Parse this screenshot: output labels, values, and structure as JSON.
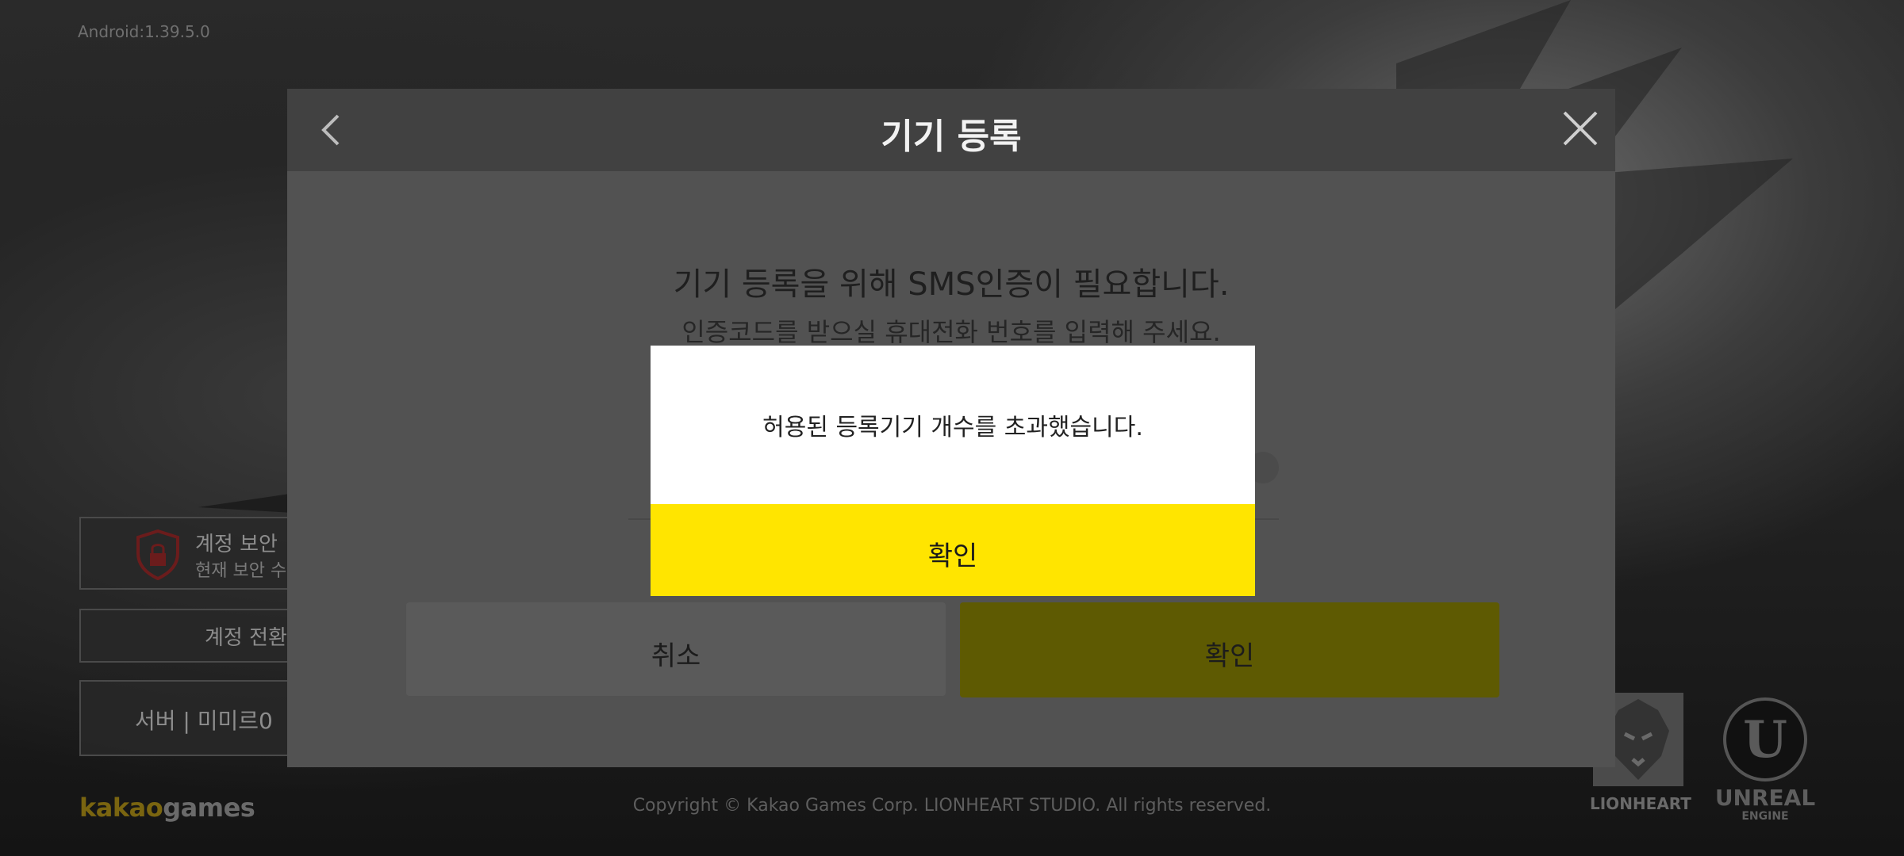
{
  "app": {
    "version": "Android:1.39.5.0"
  },
  "left_panel": {
    "security_title": "계정 보안",
    "security_subtitle": "현재 보안 수",
    "switch_account": "계정 전환",
    "server": "서버 | 미미르0"
  },
  "footer": {
    "kakao_logo_1": "kakao",
    "kakao_logo_2": "games",
    "copyright": "Copyright © Kakao Games Corp. LIONHEART STUDIO. All rights reserved.",
    "lionheart": "LIONHEART",
    "unreal_1": "UNREAL",
    "unreal_2": "ENGINE",
    "unreal_mark": "U"
  },
  "dialog": {
    "title": "기기 등록",
    "message_main": "기기 등록을 위해 SMS인증이 필요합니다.",
    "message_sub": "인증코드를 받으실 휴대전화 번호를 입력해 주세요.",
    "cancel_label": "취소",
    "confirm_label": "확인"
  },
  "alert": {
    "message": "허용된 등록기기 개수를 초과했습니다.",
    "confirm_label": "확인"
  },
  "colors": {
    "accent_yellow": "#ffe500",
    "dim_yellow": "#5e5a02"
  }
}
